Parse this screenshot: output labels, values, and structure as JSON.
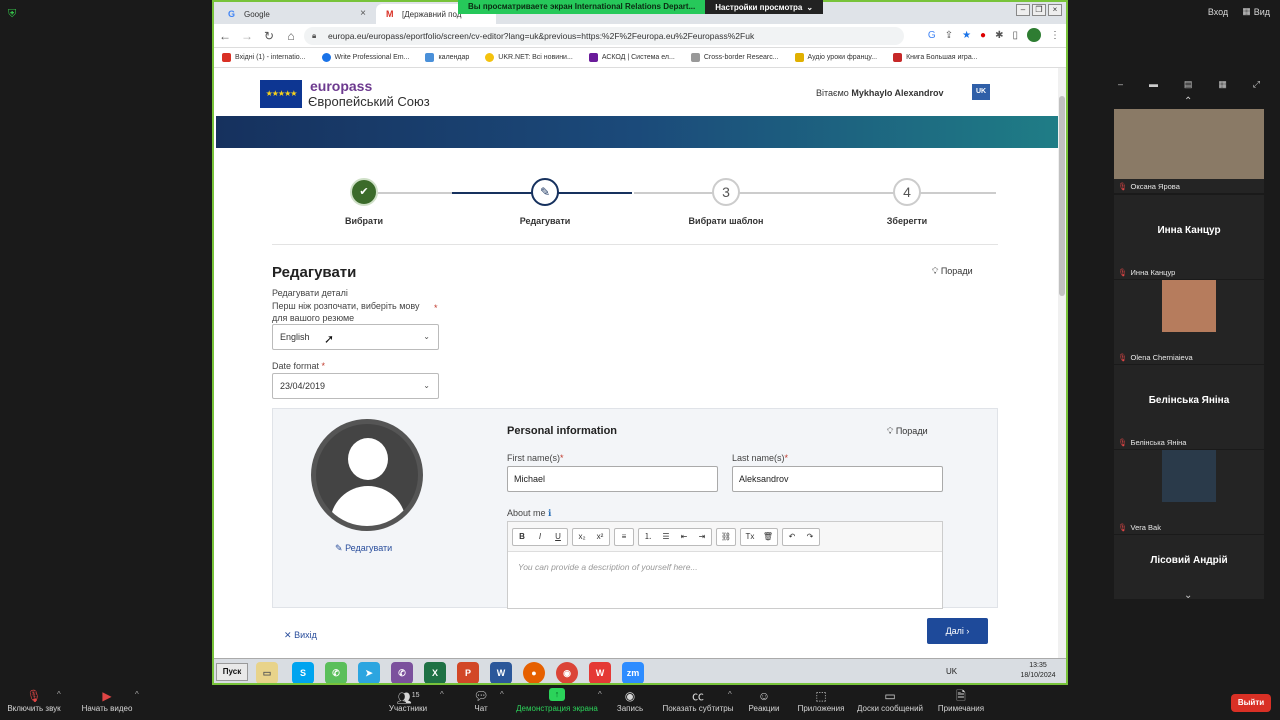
{
  "zoom": {
    "view_buttons": [
      "Вход",
      "Вид"
    ],
    "share_banner": {
      "text": "Вы просматриваете экран International Relations Depart...",
      "settings": "Настройки просмотра"
    },
    "bottom_bar": {
      "mute": "Включить звук",
      "video": "Начать видео",
      "participants": "Участники",
      "participants_count": "15",
      "chat": "Чат",
      "share": "Демонстрация экрана",
      "record": "Запись",
      "captions": "Показать субтитры",
      "reactions": "Реакции",
      "apps": "Приложения",
      "whiteboards": "Доски сообщений",
      "notes": "Примечания",
      "leave": "Выйти"
    },
    "participants": [
      {
        "name": "Оксана Ярова",
        "video": true
      },
      {
        "name": "Инна Канцур",
        "video": false,
        "display": "Инна Канцур"
      },
      {
        "name": "Olena Cherniaieva",
        "video": true
      },
      {
        "name": "Белінська Яніна",
        "video": false,
        "display": "Белінська Яніна"
      },
      {
        "name": "Vera Bak",
        "video": true
      },
      {
        "name": "Лісовий Андрій",
        "video": false,
        "display": "Лісовий Андрій"
      }
    ]
  },
  "browser": {
    "tabs": [
      {
        "label": "Google",
        "icon": "G"
      },
      {
        "label": "[Державний под",
        "icon": "M"
      }
    ],
    "url": "europa.eu/europass/eportfolio/screen/cv-editor?lang=uk&previous=https:%2F%2Feuropa.eu%2Feuropass%2Fuk",
    "bookmarks": [
      "Вхідні (1) - internatio...",
      "Write Professional Em...",
      "календар",
      "UKR.NET: Всі новини...",
      "АСКОД | Система ел...",
      "Cross-border Researc...",
      "Аудіо уроки францу...",
      "Книга Большая игра..."
    ]
  },
  "site": {
    "logo_top": "europass",
    "logo_bottom": "Європейський Союз",
    "greeting_prefix": "Вітаємо",
    "greeting_name": "Mykhaylo Alexandrov",
    "lang_badge": "UK",
    "steps": [
      {
        "num": "✔",
        "label": "Вибрати"
      },
      {
        "num": "✎",
        "label": "Редагувати"
      },
      {
        "num": "3",
        "label": "Вибрати шаблон"
      },
      {
        "num": "4",
        "label": "Зберегти"
      }
    ],
    "title": "Редагувати",
    "tips": "Поради",
    "edit_details": "Редагувати деталі",
    "language_hint_1": "Перш ніж розпочати, виберіть мову",
    "language_hint_2": "для вашого резюме",
    "language_value": "English",
    "date_format_label": "Date format",
    "date_format_value": "23/04/2019",
    "personal_info": "Personal information",
    "edit_photo": "Редагувати",
    "first_name_label": "First name(s)",
    "first_name_value": "Michael",
    "last_name_label": "Last name(s)",
    "last_name_value": "Aleksandrov",
    "about_me_label": "About me",
    "about_me_placeholder": "You can provide a description of yourself here...",
    "exit": "Вихід",
    "next": "Далі"
  },
  "taskbar": {
    "start": "Пуск",
    "lang": "UK",
    "time": "13:35",
    "date": "18/10/2024"
  }
}
